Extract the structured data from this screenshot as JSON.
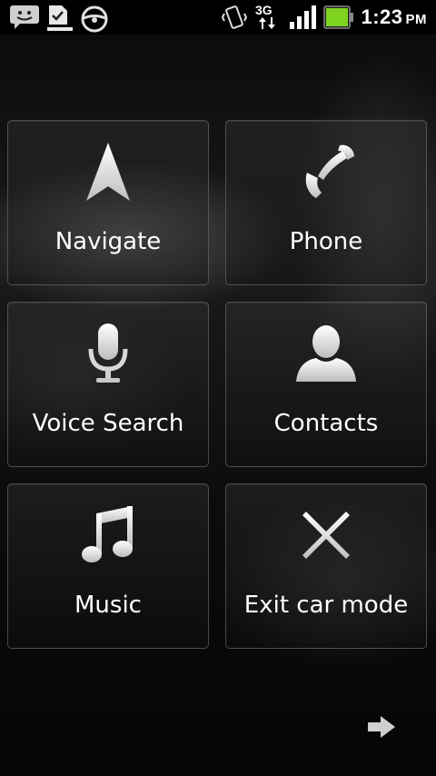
{
  "status_bar": {
    "time": "1:23",
    "ampm": "PM",
    "network": "3G",
    "icons": [
      "chat-notification-icon",
      "download-complete-icon",
      "car-mode-icon",
      "vibrate-icon",
      "3g-data-icon",
      "signal-strength-icon",
      "battery-icon"
    ]
  },
  "tiles": [
    {
      "label": "Navigate",
      "icon": "navigation-arrow-icon"
    },
    {
      "label": "Phone",
      "icon": "phone-handset-icon"
    },
    {
      "label": "Voice Search",
      "icon": "microphone-icon"
    },
    {
      "label": "Contacts",
      "icon": "person-icon"
    },
    {
      "label": "Music",
      "icon": "music-note-icon"
    },
    {
      "label": "Exit car mode",
      "icon": "close-x-icon"
    }
  ],
  "next_page_icon": "arrow-right-icon",
  "colors": {
    "battery": "#7ed321",
    "text": "#ffffff",
    "background": "#000000"
  }
}
